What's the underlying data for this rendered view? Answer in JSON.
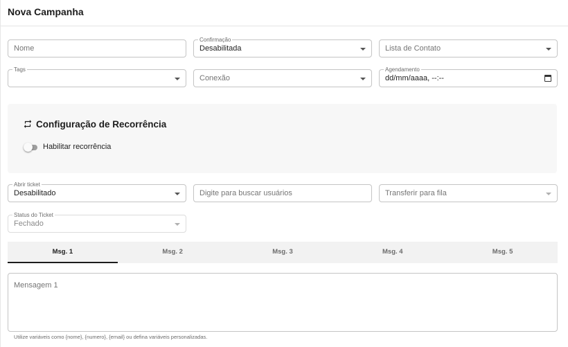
{
  "dialog": {
    "title": "Nova Campanha"
  },
  "form": {
    "nome": {
      "placeholder": "Nome"
    },
    "confirmacao": {
      "label": "Confirmação",
      "value": "Desabilitada"
    },
    "lista_contato": {
      "placeholder": "Lista de Contato"
    },
    "tags": {
      "label": "Tags",
      "value": ""
    },
    "conexao": {
      "placeholder": "Conexão"
    },
    "agendamento": {
      "label": "Agendamento",
      "value": "dd/mm/aaaa, --:--"
    },
    "abrir_ticket": {
      "label": "Abrir ticket",
      "value": "Desabilitado"
    },
    "buscar_usuarios": {
      "placeholder": "Digite para buscar usuários"
    },
    "transferir_fila": {
      "placeholder": "Transferir para fila"
    },
    "status_ticket": {
      "label": "Status do Ticket",
      "value": "Fechado"
    }
  },
  "recurrence": {
    "title": "Configuração de Recorrência",
    "toggle_label": "Habilitar recorrência",
    "enabled": false
  },
  "message_tabs": {
    "active_index": 0,
    "tabs": [
      {
        "label": "Msg. 1"
      },
      {
        "label": "Msg. 2"
      },
      {
        "label": "Msg. 3"
      },
      {
        "label": "Msg. 4"
      },
      {
        "label": "Msg. 5"
      }
    ]
  },
  "message": {
    "placeholder": "Mensagem 1",
    "hint": "Utilize variáveis como {nome}, {numero}, {email} ou defina variáveis personalizadas."
  },
  "icons": {
    "recurrence": "repeat-icon",
    "dropdown": "chevron-down-icon",
    "calendar": "calendar-icon"
  }
}
